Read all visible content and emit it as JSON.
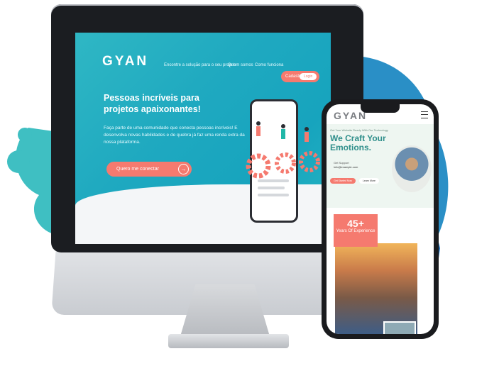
{
  "desktop": {
    "logo": "GYAN",
    "nav": {
      "item1": "Encontre a solução para o seu projeto",
      "item2": "Quem somos",
      "item3": "Como funciona"
    },
    "cadastrar_label": "Cadastrar",
    "login_label": "Login",
    "hero_title": "Pessoas incríveis para projetos apaixonantes!",
    "hero_text": "Faça parte de uma comunidade que conecta pessoas incríveis! E desenvolva novas habilidades e de quebra já faz uma renda extra da nossa plataforma.",
    "cta_label": "Quero me conectar",
    "cta_icon": "arrow-right-icon",
    "colors": {
      "accent": "#f57a6f",
      "teal": "#1fa9c0"
    }
  },
  "mobile": {
    "logo": "GYAN",
    "menu_icon": "hamburger-icon",
    "tagline": "Get Your Website Ready With Our Technology",
    "hero_title": "We Craft Your Emotions.",
    "contact_caption": "Get Support",
    "contact_email": "info@example.com",
    "primary_button": "Get Started Now",
    "secondary_button": "Learn More",
    "stat_number": "45+",
    "stat_label": "Years Of Experience"
  }
}
